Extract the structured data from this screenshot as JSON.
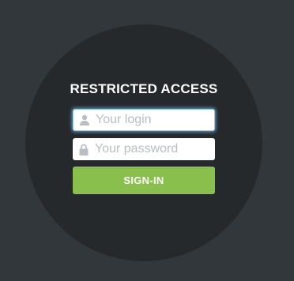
{
  "login_form": {
    "title": "RESTRICTED ACCESS",
    "login_field": {
      "placeholder": "Your login",
      "value": "",
      "icon": "user-icon"
    },
    "password_field": {
      "placeholder": "Your password",
      "value": "",
      "icon": "lock-icon"
    },
    "submit_label": "SIGN-IN"
  },
  "colors": {
    "background": "#32373b",
    "circle": "#26292c",
    "button": "#89bf4d",
    "focus_glow": "#8ec9ee",
    "placeholder_text": "#b9bec3"
  }
}
